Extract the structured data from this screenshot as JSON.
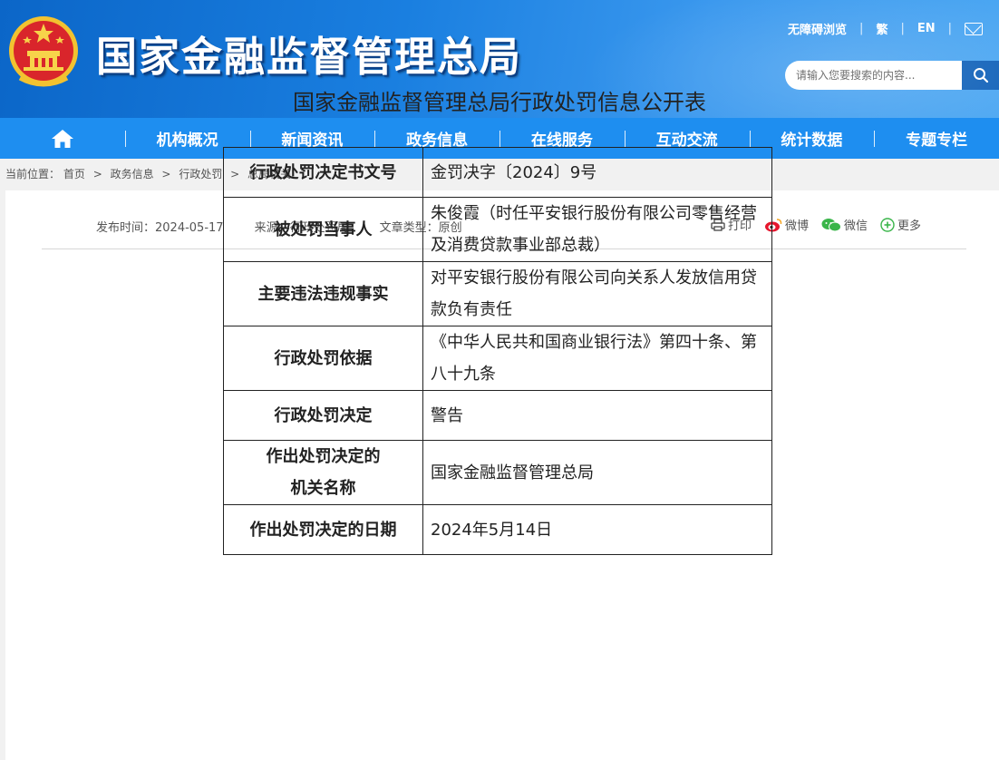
{
  "header": {
    "site_title": "国家金融监督管理总局",
    "links": [
      "无障碍浏览",
      "繁",
      "EN"
    ],
    "search_placeholder": "请输入您要搜索的内容...",
    "colors": {
      "primary": "#1e8ef0",
      "dark": "#0b66c8"
    }
  },
  "nav": {
    "home_icon": "home-icon",
    "items": [
      "机构概况",
      "新闻资讯",
      "政务信息",
      "在线服务",
      "互动交流",
      "统计数据",
      "专题专栏"
    ]
  },
  "breadcrumb": {
    "prefix": "当前位置：",
    "items": [
      "首页",
      "政务信息",
      "行政处罚",
      "总局机关"
    ],
    "sep": ">"
  },
  "article": {
    "publish_time": "发布时间：2024-05-17",
    "source": "来源：行政处罚局",
    "type": "文章类型：原创",
    "share": {
      "print": "打印",
      "weibo": "微博",
      "wechat": "微信",
      "more": "更多"
    },
    "title": "国家金融监督管理总局行政处罚信息公开表",
    "rows": [
      {
        "label": "行政处罚决定书文号",
        "value": "金罚决字〔2024〕9号"
      },
      {
        "label": "被处罚当事人",
        "value": "朱俊霞（时任平安银行股份有限公司零售经营及消费贷款事业部总裁）"
      },
      {
        "label": "主要违法违规事实",
        "value": "对平安银行股份有限公司向关系人发放信用贷款负有责任"
      },
      {
        "label": "行政处罚依据",
        "value": "《中华人民共和国商业银行法》第四十条、第八十九条"
      },
      {
        "label": "行政处罚决定",
        "value": "警告"
      },
      {
        "label": "作出处罚决定的机关名称",
        "value": "国家金融监督管理总局"
      },
      {
        "label": "作出处罚决定的日期",
        "value": "2024年5月14日"
      }
    ]
  }
}
